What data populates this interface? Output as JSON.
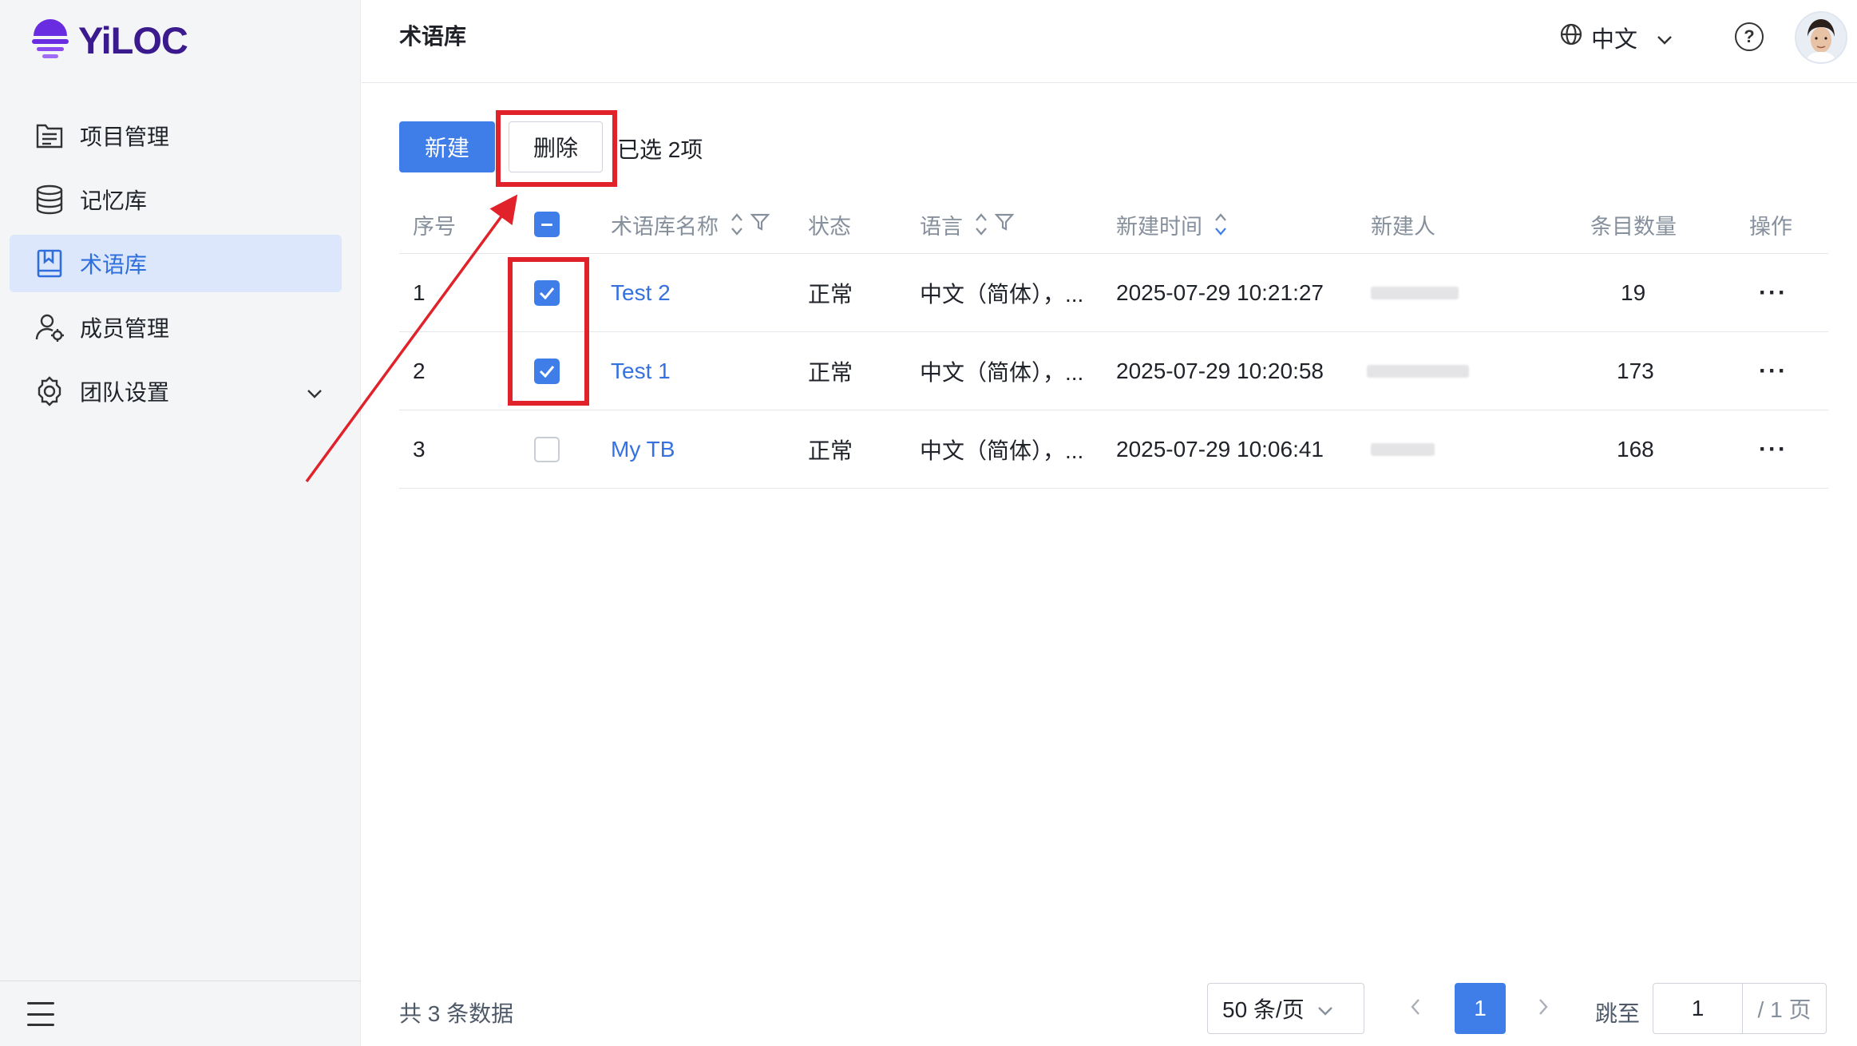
{
  "brand": {
    "name": "YiLOC"
  },
  "sidebar": {
    "items": [
      {
        "label": "项目管理",
        "icon": "file-list-icon",
        "active": false
      },
      {
        "label": "记忆库",
        "icon": "database-icon",
        "active": false
      },
      {
        "label": "术语库",
        "icon": "book-icon",
        "active": true
      },
      {
        "label": "成员管理",
        "icon": "user-gear-icon",
        "active": false
      },
      {
        "label": "团队设置",
        "icon": "gear-icon",
        "active": false
      }
    ]
  },
  "header": {
    "title": "术语库",
    "language": "中文"
  },
  "toolbar": {
    "new_label": "新建",
    "delete_label": "删除",
    "selected_text": "已选 2项"
  },
  "table": {
    "columns": [
      "序号",
      "术语库名称",
      "状态",
      "语言",
      "新建时间",
      "新建人",
      "条目数量",
      "操作"
    ],
    "rows": [
      {
        "index": "1",
        "checked": true,
        "name": "Test 2",
        "status": "正常",
        "language": "中文（简体），...",
        "created": "2025-07-29 10:21:27",
        "entries": "19"
      },
      {
        "index": "2",
        "checked": true,
        "name": "Test 1",
        "status": "正常",
        "language": "中文（简体），...",
        "created": "2025-07-29 10:20:58",
        "entries": "173"
      },
      {
        "index": "3",
        "checked": false,
        "name": "My TB",
        "status": "正常",
        "language": "中文（简体），...",
        "created": "2025-07-29 10:06:41",
        "entries": "168"
      }
    ]
  },
  "pagination": {
    "total_text": "共 3 条数据",
    "page_size": "50 条/页",
    "current_page": "1",
    "jump_label": "跳至",
    "jump_value": "1",
    "total_pages": "/ 1 页"
  },
  "colors": {
    "accent": "#3f7de9",
    "annotation": "#e1222b"
  }
}
